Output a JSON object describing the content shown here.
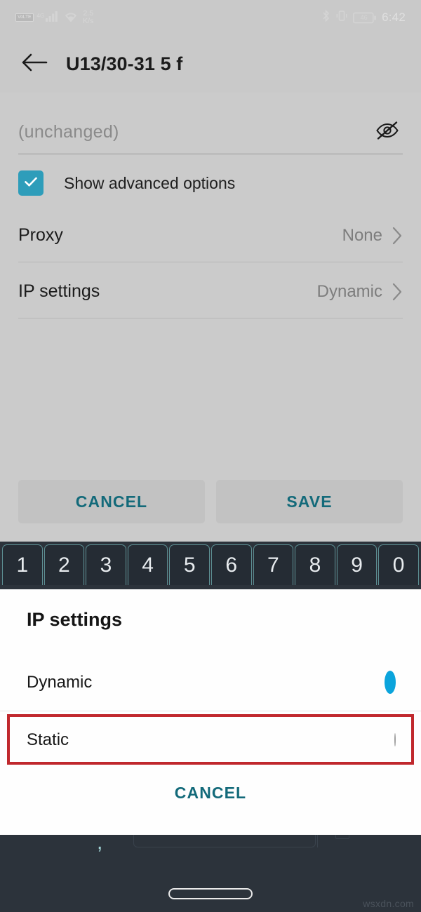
{
  "status_bar": {
    "volte_badge": "VoLTE",
    "network_type": "4G",
    "data_rate_value": "2.5",
    "data_rate_unit": "K/s",
    "bluetooth_icon": "bluetooth-icon",
    "vibrate_icon": "vibrate-icon",
    "battery_level": "46",
    "time": "6:42"
  },
  "app_bar": {
    "back_icon": "arrow-back-icon",
    "title": "U13/30-31 5 f"
  },
  "form": {
    "password_placeholder": "(unchanged)",
    "password_value": "",
    "visibility_icon": "eye-off-icon",
    "advanced_checkbox": {
      "label": "Show advanced options",
      "checked": true
    },
    "rows": [
      {
        "label": "Proxy",
        "value": "None",
        "chevron": "chevron-right-icon"
      },
      {
        "label": "IP settings",
        "value": "Dynamic",
        "chevron": "chevron-right-icon"
      }
    ],
    "cancel_label": "CANCEL",
    "save_label": "SAVE"
  },
  "keyboard": {
    "number_row": [
      "1",
      "2",
      "3",
      "4",
      "5",
      "6",
      "7",
      "8",
      "9",
      "0"
    ],
    "comma_key": ","
  },
  "dialog": {
    "title": "IP settings",
    "options": [
      {
        "label": "Dynamic",
        "selected": true
      },
      {
        "label": "Static",
        "selected": false
      }
    ],
    "cancel_label": "CANCEL",
    "highlighted_option": "Static"
  },
  "nav": {
    "home_indicator": "home-indicator"
  },
  "watermark": "wsxdn.com",
  "colors": {
    "screen_background": "#c9c9c9",
    "panel_background": "#cbcbcb",
    "accent_teal": "#2e9dba",
    "accent_blue": "#0ba4dc",
    "button_text": "#136a7a",
    "keyboard_background": "#2c333b",
    "key_outline": "#5d8f93",
    "highlight_red": "#c0282d",
    "dialog_background": "#fefefe"
  }
}
